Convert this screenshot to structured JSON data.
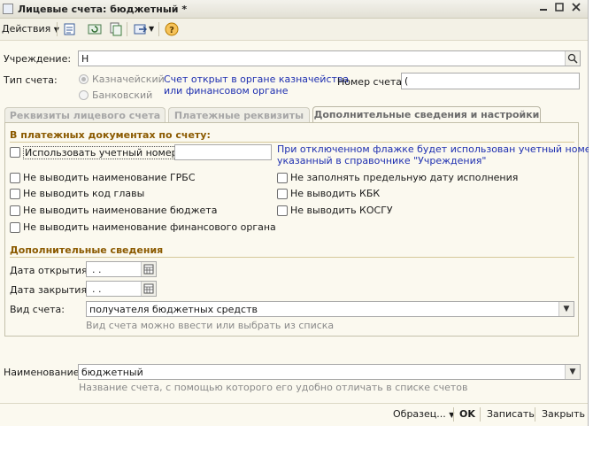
{
  "window": {
    "title": "Лицевые счета: бюджетный *"
  },
  "toolbar": {
    "actions_label": "Действия"
  },
  "form": {
    "institution_label": "Учреждение:",
    "institution_value": "Н",
    "account_type_label": "Тип счета:",
    "radio_treasury": "Казначейский",
    "radio_bank": "Банковский",
    "account_hint": [
      "Счет открыт в органе казначейства",
      "или финансовом органе"
    ],
    "account_number_label": "Номер счета:",
    "account_number_value": "("
  },
  "tabs": [
    {
      "label": "Реквизиты лицевого счета"
    },
    {
      "label": "Платежные реквизиты"
    },
    {
      "label": "Дополнительные сведения и настройки"
    }
  ],
  "payment_section": {
    "title": "В платежных документах по счету:",
    "use_account_number": "Использовать учетный номер",
    "use_hint": [
      "При отключенном флажке будет использован учетный номер,",
      "указанный в справочнике \"Учреждения\""
    ],
    "left_checkboxes": [
      "Не выводить наименование ГРБС",
      "Не выводить код главы",
      "Не выводить наименование бюджета",
      "Не выводить наименование финансового органа"
    ],
    "right_checkboxes": [
      "Не заполнять предельную дату исполнения",
      "Не выводить КБК",
      "Не выводить КОСГУ"
    ]
  },
  "extra_section": {
    "title": "Дополнительные сведения",
    "open_date_label": "Дата открытия:",
    "open_date_value": ". .",
    "close_date_label": "Дата закрытия:",
    "close_date_value": ". .",
    "account_kind_label": "Вид счета:",
    "account_kind_value": "получателя бюджетных средств",
    "account_kind_hint": "Вид счета можно ввести или выбрать из списка"
  },
  "name": {
    "label": "Наименование:",
    "value": "бюджетный",
    "hint": "Название счета, с помощью которого его удобно отличать в списке счетов"
  },
  "bottom": {
    "template_label": "Образец...",
    "ok_label": "OK",
    "save_label": "Записать",
    "close_label": "Закрыть"
  }
}
